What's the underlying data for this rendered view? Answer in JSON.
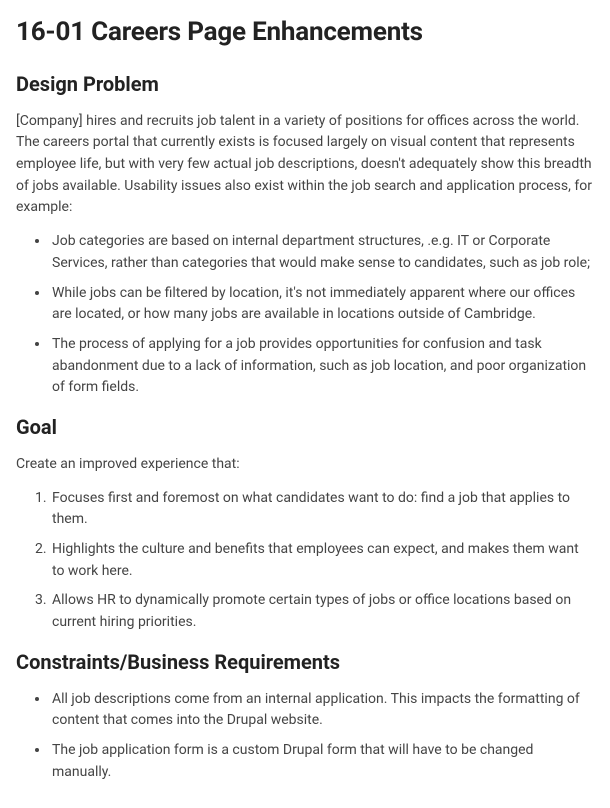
{
  "title": "16-01 Careers Page Enhancements",
  "sections": {
    "design_problem": {
      "heading": "Design Problem",
      "intro": "[Company] hires and recruits job talent in a variety of positions for offices across the world. The careers portal that currently exists is focused largely on visual content that represents employee life, but with very few actual job descriptions, doesn't adequately show this breadth of jobs available. Usability issues also exist within the job search and application process, for example:",
      "bullets": [
        "Job categories are based on internal department structures, .e.g. IT or Corporate Services, rather than categories that would make sense to candidates, such as job role;",
        "While jobs can be filtered by location, it's not immediately apparent where our offices are located, or how many jobs are available in locations outside of Cambridge.",
        "The process of applying for a job provides opportunities for confusion and task abandonment due to a lack of information, such as job location, and poor organization of form fields."
      ]
    },
    "goal": {
      "heading": "Goal",
      "intro": "Create an improved experience that:",
      "items": [
        "Focuses first and foremost on what candidates want to do: find a job that applies to them.",
        "Highlights the culture and benefits that employees can expect, and makes them want to work here.",
        "Allows HR to dynamically promote certain types of jobs or office locations based on current hiring priorities."
      ]
    },
    "constraints": {
      "heading": "Constraints/Business Requirements",
      "bullets": [
        "All job descriptions come from an internal application. This impacts the formatting of content that comes into the Drupal website.",
        "The job application form is a custom Drupal form that will have to be changed manually."
      ]
    }
  }
}
